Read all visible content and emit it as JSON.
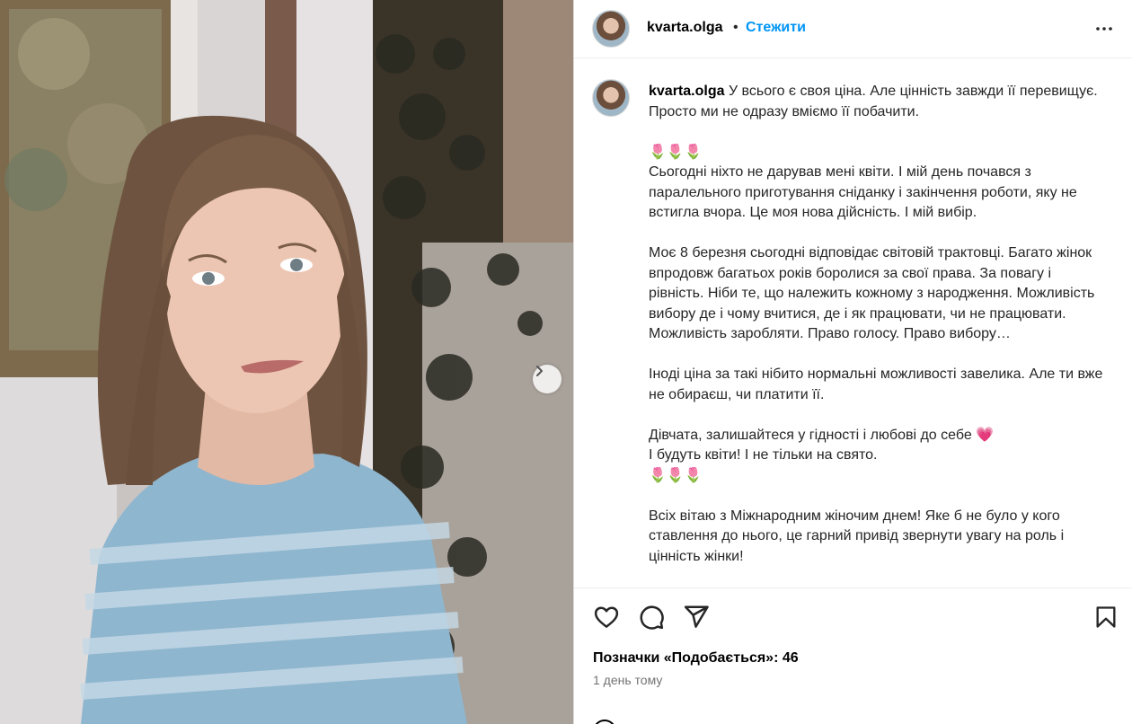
{
  "post": {
    "username": "kvarta.olga",
    "dot": "•",
    "follow_label": "Стежити",
    "caption": "У всього є своя ціна. Але цінність завжди її перевищує. Просто ми не одразу вміємо її побачити.\n\n🌷🌷🌷\nСьогодні ніхто не дарував мені квіти. І мій день почався з паралельного приготування сніданку і закінчення роботи, яку не встигла вчора. Це моя нова дійсність. І мій вибір.\n\nМоє 8 березня сьогодні відповідає світовій трактовці. Багато жінок впродовж багатьох років боролися за свої права. За повагу і рівність. Ніби те, що належить кожному з народження. Можливість вибору де і чому вчитися, де і як працювати, чи не працювати. Можливість заробляти. Право голосу. Право вибору…\n\nІноді ціна за такі нібито нормальні можливості завелика. Але ти вже не обираєш, чи платити її.\n\nДівчата, залишайтеся у гідності і любові до себе 💗\nІ будуть квіти! І не тільки на свято.\n🌷🌷🌷\n\nВсіх вітаю з Міжнародним жіночим днем! Яке б не було у кого ставлення до нього, це гарний привід звернути увагу на роль і цінність жінки!",
    "likes_text": "Позначки «Подобається»: 46",
    "time_text": "1 день тому"
  },
  "icons": {
    "like": "heart-icon",
    "comment": "comment-icon",
    "share": "share-icon",
    "save": "bookmark-icon",
    "more": "more-icon",
    "next": "chevron-right-icon"
  },
  "colors": {
    "accent": "#0095f6",
    "border": "#dbdbdb",
    "muted": "#737373"
  }
}
